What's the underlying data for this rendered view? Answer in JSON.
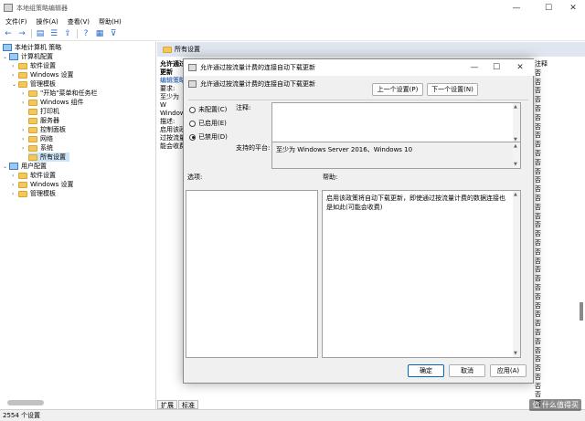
{
  "window": {
    "title": "本地组策略编辑器"
  },
  "menu": [
    "文件(F)",
    "操作(A)",
    "查看(V)",
    "帮助(H)"
  ],
  "tree": {
    "root": "本地计算机 策略",
    "computer_config": "计算机配置",
    "software_settings": "软件设置",
    "windows_settings": "Windows 设置",
    "admin_templates": "管理模板",
    "start_menu": "\"开始\"菜单和任务栏",
    "windows_components": "Windows 组件",
    "printers": "打印机",
    "server": "服务器",
    "control_panel": "控制面板",
    "network": "网络",
    "system": "系统",
    "all_settings": "所有设置",
    "user_config": "用户配置",
    "user_software_settings": "软件设置",
    "user_windows_settings": "Windows 设置",
    "user_admin_templates": "管理模板"
  },
  "right_pane": {
    "header": "所有设置",
    "state_col_header": "注释",
    "state_values": [
      "否",
      "否",
      "否",
      "否",
      "否",
      "否",
      "否",
      "否",
      "否",
      "否",
      "否",
      "否",
      "否",
      "否",
      "否",
      "否",
      "否",
      "否",
      "否",
      "否",
      "否",
      "否",
      "否",
      "否",
      "否",
      "否",
      "否",
      "否",
      "否",
      "否",
      "否",
      "否",
      "否",
      "否",
      "否",
      "否",
      "否",
      "否"
    ],
    "desc_lines": [
      "允许通过",
      "更新",
      "",
      "编辑策略",
      "",
      "要求:",
      "至少为 W",
      "Window",
      "",
      "描述:",
      "启用该政",
      "过按流量",
      "能会收费"
    ],
    "tabs": [
      "扩展",
      "标准"
    ]
  },
  "status": {
    "text": "2554 个设置"
  },
  "watermark": "值 什么值得买",
  "dialog": {
    "title": "允许通过按流量计费的连接自动下载更新",
    "policy_name": "允许通过按流量计费的连接自动下载更新",
    "prev_label": "上一个设置(P)",
    "next_label": "下一个设置(N)",
    "radio_not_configured": "未配置(C)",
    "radio_enabled": "已启用(E)",
    "radio_disabled": "已禁用(D)",
    "comment_label": "注释:",
    "platform_label": "支持的平台:",
    "platform_value": "至少为 Windows Server 2016、Windows 10",
    "options_label": "选项:",
    "help_label": "帮助:",
    "help_text": "启用该政策将自动下载更新，即使通过按流量计费的数据连接也是如此(可能会收费)",
    "ok_label": "确定",
    "cancel_label": "取消",
    "apply_label": "应用(A)"
  }
}
